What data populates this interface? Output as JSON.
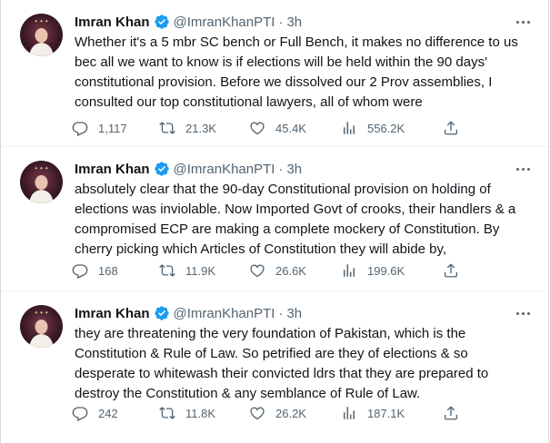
{
  "tweets": [
    {
      "name": "Imran Khan",
      "handle": "@ImranKhanPTI",
      "separator": "·",
      "time": "3h",
      "lines": [
        "Whether it's a 5 mbr SC bench or Full Bench, it makes no difference to us",
        "bec all we want to know is if elections  will be held within the 90 days'",
        "constitutional provision. Before we dissolved our 2 Prov assemblies, I",
        "consulted our top constitutional lawyers, all of whom were"
      ],
      "replies": "1,117",
      "retweets": "21.3K",
      "likes": "45.4K",
      "views": "556.2K"
    },
    {
      "name": "Imran Khan",
      "handle": "@ImranKhanPTI",
      "separator": "·",
      "time": "3h",
      "lines": [
        "absolutely clear that the 90-day Constitutional provision on holding of",
        "elections was inviolable. Now Imported Govt of crooks, their handlers & a",
        "compromised ECP are making a complete mockery of Constitution. By",
        "cherry picking which Articles of Constitution they will abide by,"
      ],
      "replies": "168",
      "retweets": "11.9K",
      "likes": "26.6K",
      "views": "199.6K"
    },
    {
      "name": "Imran Khan",
      "handle": "@ImranKhanPTI",
      "separator": "·",
      "time": "3h",
      "lines": [
        "they are threatening the very foundation of Pakistan, which is the",
        "Constitution & Rule of Law. So petrified are they of elections & so",
        "desperate to whitewash their convicted ldrs that they are prepared to",
        "destroy the Constitution & any semblance of Rule of Law."
      ],
      "replies": "242",
      "retweets": "11.8K",
      "likes": "26.2K",
      "views": "187.1K"
    }
  ],
  "colors": {
    "text": "#0f1419",
    "secondary": "#536471",
    "verified": "#1d9bf0",
    "divider": "#eff3f4"
  },
  "icons": [
    "verified-badge-icon",
    "more-icon",
    "reply-icon",
    "retweet-icon",
    "like-icon",
    "views-icon",
    "share-icon"
  ]
}
